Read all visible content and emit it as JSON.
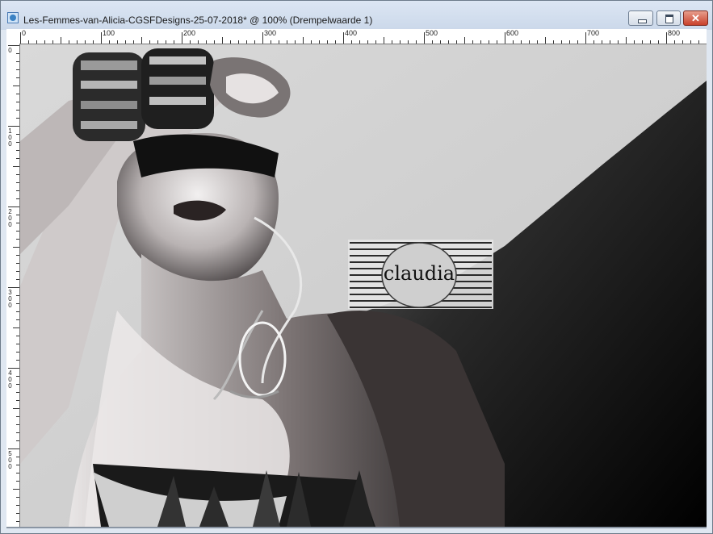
{
  "window": {
    "title": "Les-Femmes-van-Alicia-CGSFDesigns-25-07-2018* @ 100% (Drempelwaarde 1)",
    "buttons": {
      "minimize": "minimize",
      "maximize": "maximize",
      "close": "✕"
    }
  },
  "ruler": {
    "horizontal_labels": [
      "0",
      "100",
      "200",
      "300",
      "400",
      "500",
      "600",
      "700",
      "800"
    ],
    "vertical_labels": [
      "0",
      "100",
      "200",
      "300",
      "400",
      "500"
    ]
  },
  "canvas": {
    "watermark_text": "claudia"
  },
  "colors": {
    "titlebar": "#cbd8ea",
    "close_button": "#c9412c",
    "background_light": "#d3d3d3",
    "background_dark": "#000000"
  },
  "icons": [
    "app-icon",
    "minimize-icon",
    "maximize-icon",
    "close-icon"
  ]
}
